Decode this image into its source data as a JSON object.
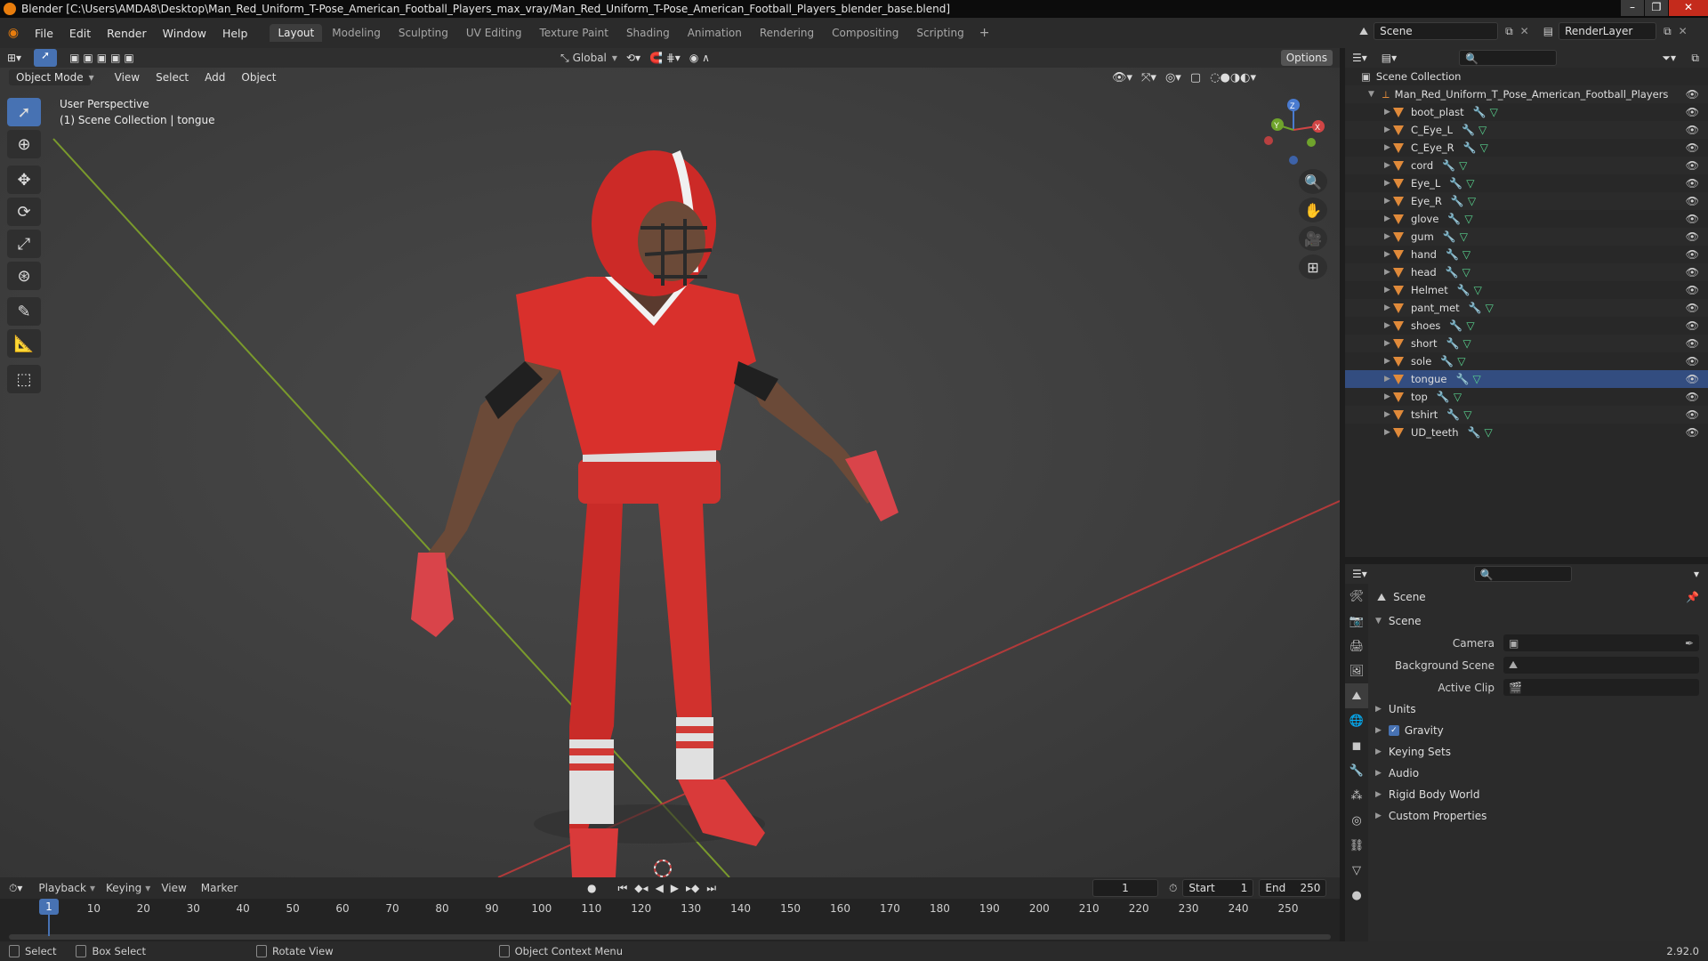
{
  "window": {
    "title": "Blender [C:\\Users\\AMDA8\\Desktop\\Man_Red_Uniform_T-Pose_American_Football_Players_max_vray/Man_Red_Uniform_T-Pose_American_Football_Players_blender_base.blend]"
  },
  "menu": [
    "File",
    "Edit",
    "Render",
    "Window",
    "Help"
  ],
  "workspaces": [
    {
      "label": "Layout",
      "active": true
    },
    {
      "label": "Modeling"
    },
    {
      "label": "Sculpting"
    },
    {
      "label": "UV Editing"
    },
    {
      "label": "Texture Paint"
    },
    {
      "label": "Shading"
    },
    {
      "label": "Animation"
    },
    {
      "label": "Rendering"
    },
    {
      "label": "Compositing"
    },
    {
      "label": "Scripting"
    }
  ],
  "scene_selector": {
    "value": "Scene"
  },
  "render_layer": {
    "value": "RenderLayer"
  },
  "viewport": {
    "transform_orientation": "Global",
    "options_label": "Options",
    "mode": "Object Mode",
    "header_menus": [
      "View",
      "Select",
      "Add",
      "Object"
    ],
    "overlay_title": "User Perspective",
    "overlay_subtitle": "(1) Scene Collection | tongue",
    "gizmo_labels": {
      "x": "X",
      "y": "Y",
      "z": "Z"
    }
  },
  "outliner": {
    "root": "Scene Collection",
    "collection": "Man_Red_Uniform_T_Pose_American_Football_Players",
    "objects": [
      "boot_plast",
      "C_Eye_L",
      "C_Eye_R",
      "cord",
      "Eye_L",
      "Eye_R",
      "glove",
      "gum",
      "hand",
      "head",
      "Helmet",
      "pant_met",
      "shoes",
      "short",
      "sole",
      "tongue",
      "top",
      "tshirt",
      "UD_teeth"
    ],
    "selected": "tongue"
  },
  "properties": {
    "context": "Scene",
    "panel_title": "Scene",
    "fields": [
      {
        "label": "Camera",
        "value": ""
      },
      {
        "label": "Background Scene",
        "value": ""
      },
      {
        "label": "Active Clip",
        "value": ""
      }
    ],
    "subpanels": [
      {
        "label": "Units"
      },
      {
        "label": "Gravity",
        "checkbox": true,
        "checked": true
      },
      {
        "label": "Keying Sets"
      },
      {
        "label": "Audio"
      },
      {
        "label": "Rigid Body World"
      },
      {
        "label": "Custom Properties"
      }
    ]
  },
  "timeline": {
    "menus": [
      "Playback",
      "Keying",
      "View",
      "Marker"
    ],
    "current_frame": "1",
    "start_label": "Start",
    "start": "1",
    "end_label": "End",
    "end": "250",
    "ticks": [
      "1",
      "10",
      "20",
      "30",
      "40",
      "50",
      "60",
      "70",
      "80",
      "90",
      "100",
      "110",
      "120",
      "130",
      "140",
      "150",
      "160",
      "170",
      "180",
      "190",
      "200",
      "210",
      "220",
      "230",
      "240",
      "250"
    ]
  },
  "statusbar": {
    "items": [
      "Select",
      "Box Select",
      "Rotate View",
      "Object Context Menu"
    ],
    "version": "2.92.0"
  },
  "colors": {
    "accent": "#4772b3",
    "uniform_red": "#d9302c",
    "grid_red": "#b23a3a",
    "grid_green": "#7a9a2c"
  }
}
